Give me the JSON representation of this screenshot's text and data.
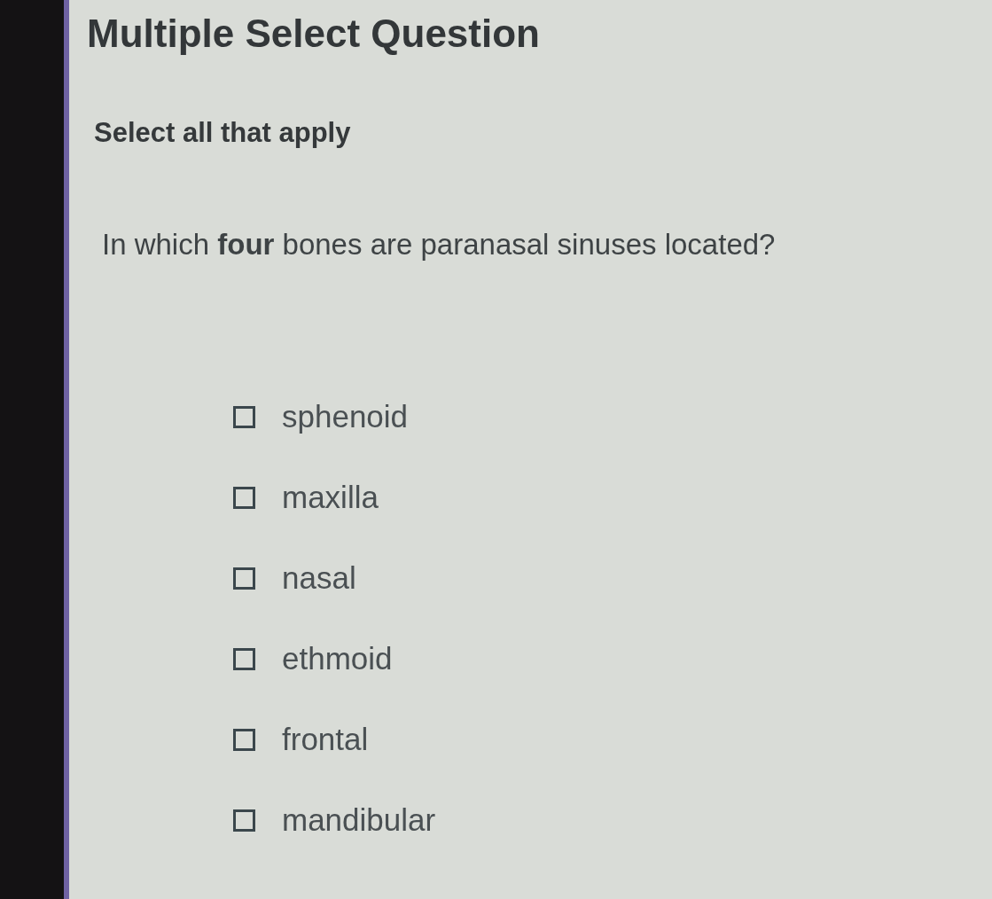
{
  "title": "Multiple Select Question",
  "instruction": "Select all that apply",
  "question": "In which **four** bones are paranasal sinuses located?",
  "options": [
    {
      "label": "sphenoid",
      "checked": false
    },
    {
      "label": "maxilla",
      "checked": false
    },
    {
      "label": "nasal",
      "checked": false
    },
    {
      "label": "ethmoid",
      "checked": false
    },
    {
      "label": "frontal",
      "checked": false
    },
    {
      "label": "mandibular",
      "checked": false
    }
  ]
}
